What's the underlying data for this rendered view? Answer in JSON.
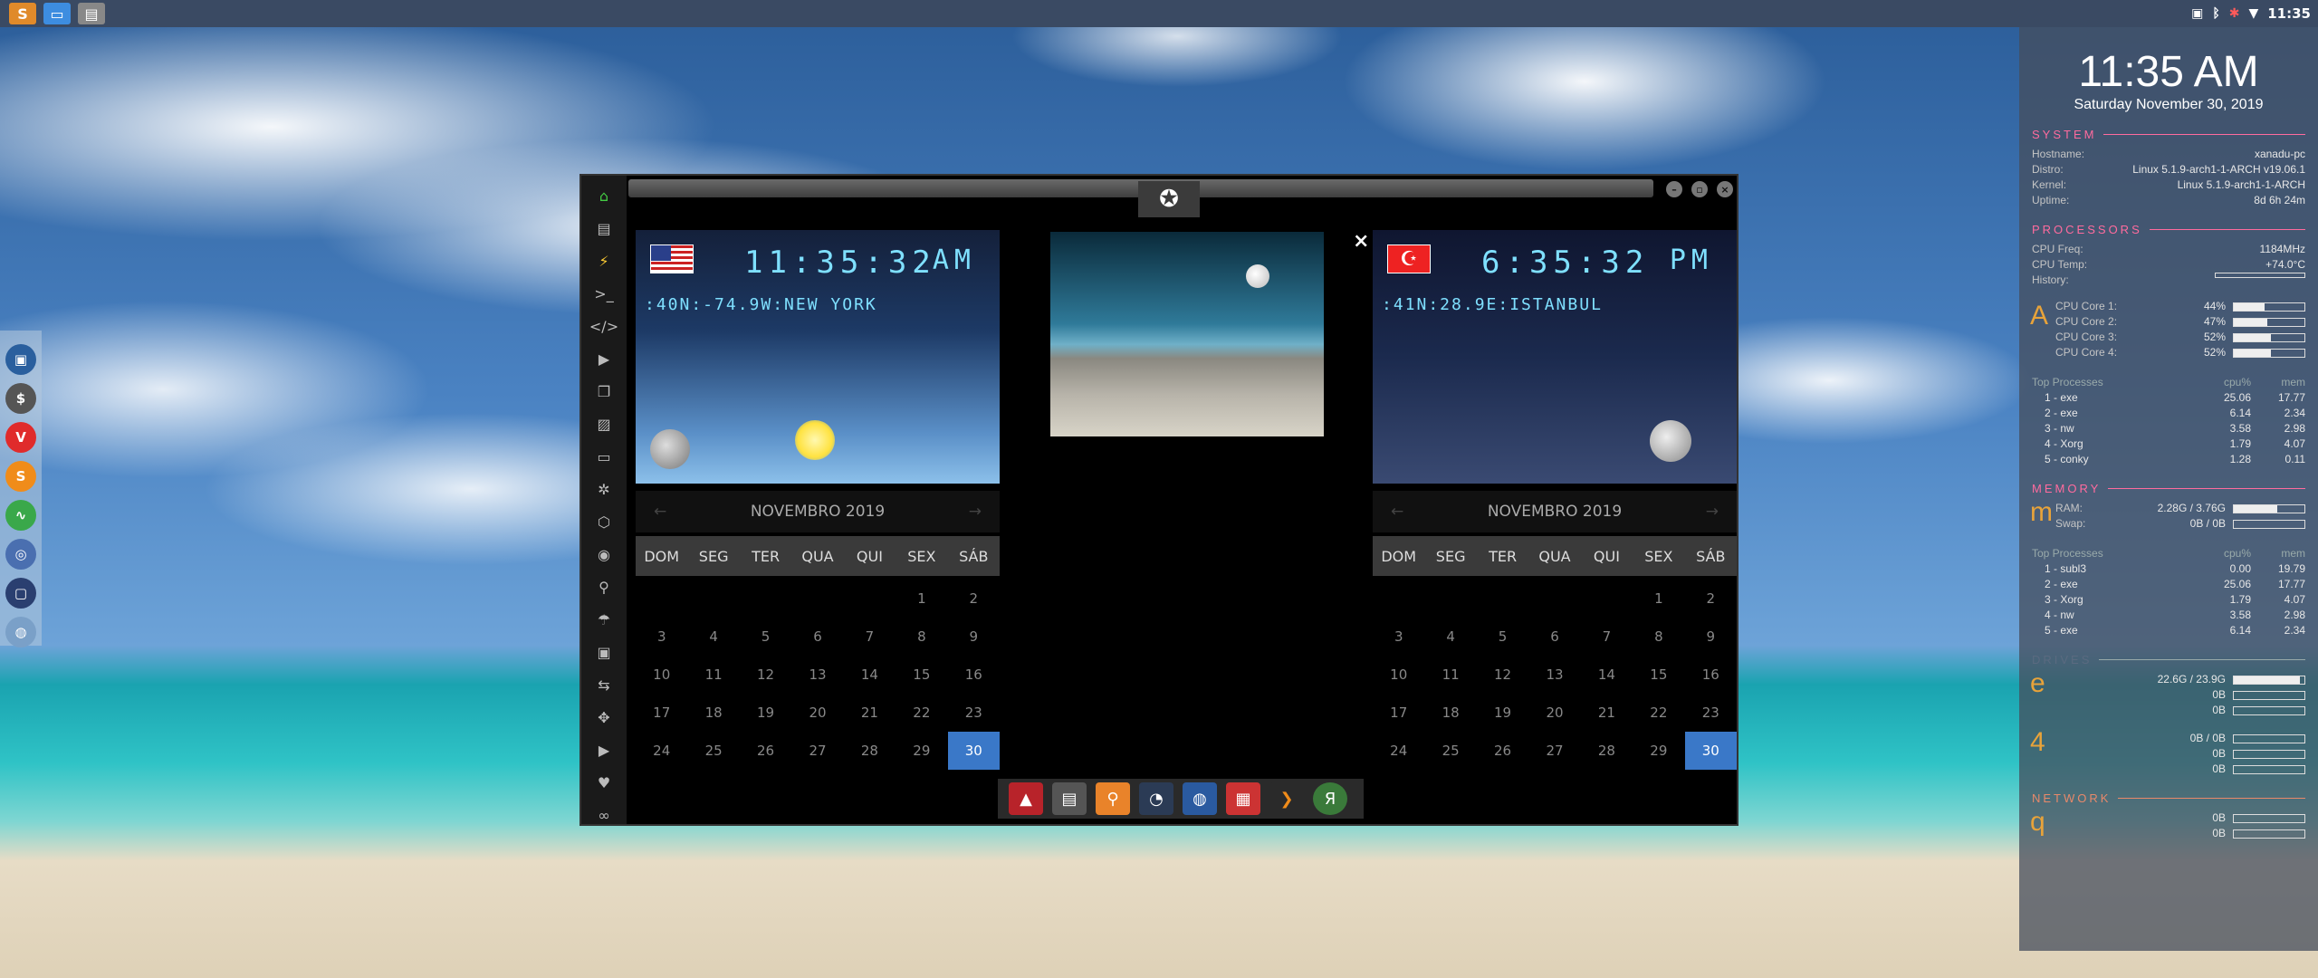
{
  "topbar": {
    "clock": "11:35"
  },
  "window": {
    "left_clock": {
      "time": "11:35:32",
      "ampm": "AM",
      "location": ":40N:-74.9W:NEW YORK"
    },
    "right_clock": {
      "time": "6:35:32",
      "ampm": "PM",
      "location": ":41N:28.9E:ISTANBUL"
    },
    "close_label": "×"
  },
  "calendar": {
    "month": "NOVEMBRO 2019",
    "days": [
      "DOM",
      "SEG",
      "TER",
      "QUA",
      "QUI",
      "SEX",
      "SÁB"
    ],
    "dates": [
      "",
      "",
      "",
      "",
      "",
      "1",
      "2",
      "3",
      "4",
      "5",
      "6",
      "7",
      "8",
      "9",
      "10",
      "11",
      "12",
      "13",
      "14",
      "15",
      "16",
      "17",
      "18",
      "19",
      "20",
      "21",
      "22",
      "23",
      "24",
      "25",
      "26",
      "27",
      "28",
      "29",
      "30"
    ],
    "selected": "30"
  },
  "conky": {
    "time": "11:35 AM",
    "date": "Saturday November 30, 2019",
    "system_title": "SYSTEM",
    "hostname_k": "Hostname:",
    "hostname_v": "xanadu-pc",
    "distro_k": "Distro:",
    "distro_v": "Linux 5.1.9-arch1-1-ARCH v19.06.1",
    "kernel_k": "Kernel:",
    "kernel_v": "Linux 5.1.9-arch1-1-ARCH",
    "uptime_k": "Uptime:",
    "uptime_v": "8d 6h 24m",
    "proc_title": "PROCESSORS",
    "freq_k": "CPU Freq:",
    "freq_v": "1184MHz",
    "temp_k": "CPU Temp:",
    "temp_v": "+74.0°C",
    "history_k": "History:",
    "cores": [
      {
        "k": "CPU Core 1:",
        "v": "44%",
        "pct": 44
      },
      {
        "k": "CPU Core 2:",
        "v": "47%",
        "pct": 47
      },
      {
        "k": "CPU Core 3:",
        "v": "52%",
        "pct": 52
      },
      {
        "k": "CPU Core 4:",
        "v": "52%",
        "pct": 52
      }
    ],
    "top_label": "Top Processes",
    "cpu_label": "cpu%",
    "mem_label": "mem",
    "top_cpu": [
      [
        "1 - exe",
        "25.06",
        "17.77"
      ],
      [
        "2 - exe",
        "6.14",
        "2.34"
      ],
      [
        "3 - nw",
        "3.58",
        "2.98"
      ],
      [
        "4 - Xorg",
        "1.79",
        "4.07"
      ],
      [
        "5 - conky",
        "1.28",
        "0.11"
      ]
    ],
    "mem_title": "MEMORY",
    "ram_k": "RAM:",
    "ram_v": "2.28G / 3.76G",
    "ram_pct": 61,
    "swap_k": "Swap:",
    "swap_v": "0B / 0B",
    "top_mem": [
      [
        "1 - subl3",
        "0.00",
        "19.79"
      ],
      [
        "2 - exe",
        "25.06",
        "17.77"
      ],
      [
        "3 - Xorg",
        "1.79",
        "4.07"
      ],
      [
        "4 - nw",
        "3.58",
        "2.98"
      ],
      [
        "5 - exe",
        "6.14",
        "2.34"
      ]
    ],
    "drives_title": "DRIVES",
    "drive1_v": "22.6G / 23.9G",
    "drive1_pct": 94,
    "zero": "0B",
    "drive2_v": "0B / 0B",
    "network_title": "NETWORK",
    "glyph_a": "A",
    "glyph_m": "m",
    "glyph_e": "e",
    "glyph_4": "4",
    "glyph_q": "q"
  }
}
